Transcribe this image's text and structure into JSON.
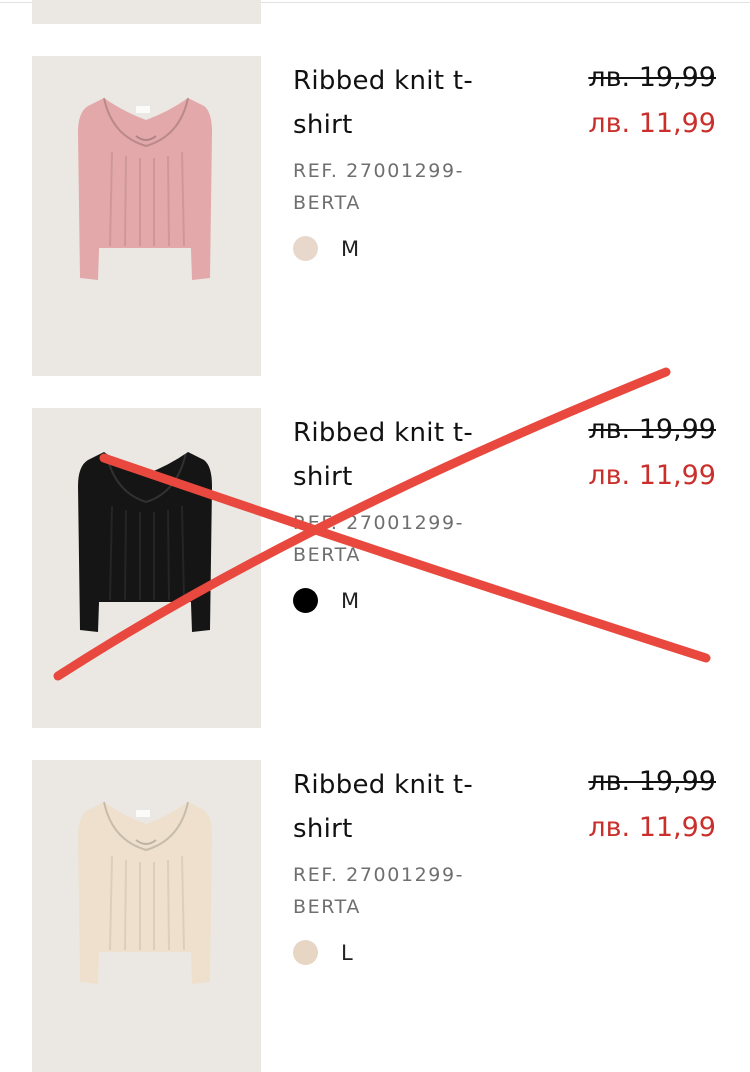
{
  "products": [
    {
      "name": "Ribbed knit t-\nshirt",
      "ref": "REF. 27001299-\nBERTA",
      "size": "M",
      "swatch_color": "#e8d8cc",
      "garment_color": "#e3a8a9",
      "price_old": "лв. 19,99",
      "price_new": "лв. 11,99",
      "crossed_out": false
    },
    {
      "name": "Ribbed knit t-\nshirt",
      "ref": "REF. 27001299-\nBERTA",
      "size": "M",
      "swatch_color": "#000000",
      "garment_color": "#151515",
      "price_old": "лв. 19,99",
      "price_new": "лв. 11,99",
      "crossed_out": true
    },
    {
      "name": "Ribbed knit t-\nshirt",
      "ref": "REF. 27001299-\nBERTA",
      "size": "L",
      "swatch_color": "#e6d6c3",
      "garment_color": "#eee0cd",
      "price_old": "лв. 19,99",
      "price_new": "лв. 11,99",
      "crossed_out": false
    }
  ],
  "colors": {
    "sale_price": "#c9302c",
    "cross_mark": "#e8483d",
    "image_background": "#ebe8e3"
  }
}
